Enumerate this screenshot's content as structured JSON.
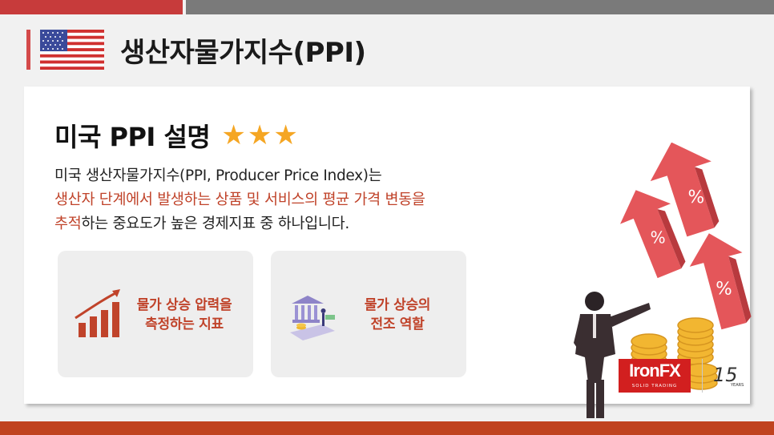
{
  "header": {
    "title": "생산자물가지수(PPI)",
    "flag_icon": "us-flag-icon"
  },
  "card": {
    "heading": "미국 PPI 설명",
    "stars": "★★★",
    "description": {
      "line1": "미국 생산자물가지수(PPI, Producer Price Index)는",
      "highlight1": "생산자 단계에서 발생하는 상품 및 서비스의 평균 가격 변동을",
      "highlight2": "추적",
      "rest": "하는 중요도가 높은 경제지표 중 하나입니다."
    },
    "features": [
      {
        "line1": "물가 상승 압력을",
        "line2": "측정하는 지표",
        "icon": "rising-bar-chart-icon"
      },
      {
        "line1": "물가 상승의",
        "line2": "전조 역할",
        "icon": "bank-money-icon"
      }
    ]
  },
  "logos": {
    "brand": "IronFX",
    "tagline": "SOLID TRADING",
    "anniversary_number": "15",
    "anniversary_word": "YEARS"
  },
  "colors": {
    "accent_red": "#c0432a",
    "star": "#f5a623",
    "top_bar_red": "#c73b3b",
    "top_bar_gray": "#7a7a7a",
    "bottom_bar": "#c0431f"
  }
}
